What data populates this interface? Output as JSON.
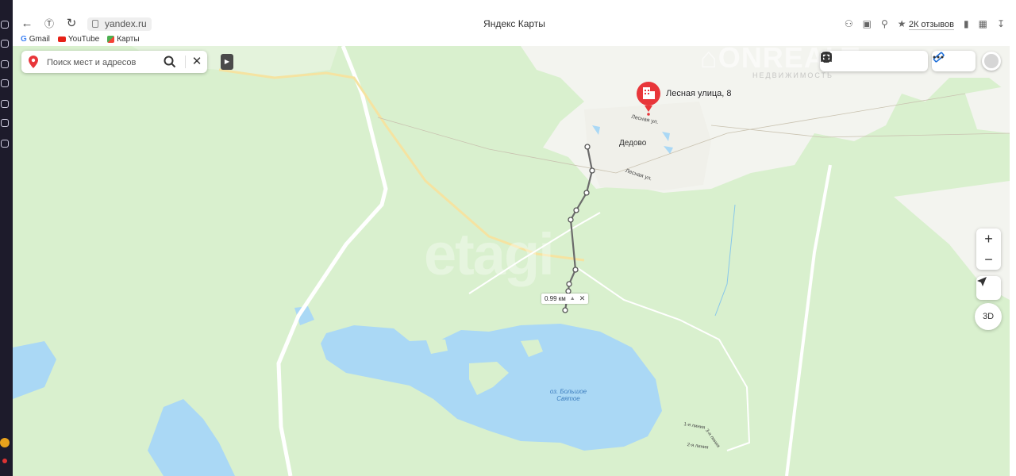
{
  "browser": {
    "url": "yandex.ru",
    "title": "Яндекс Карты",
    "reviews": "2К отзывов",
    "nav": {
      "back_icon": "arrow-left-icon",
      "yandex_icon": "yandex-logo-icon",
      "reload_icon": "reload-icon"
    },
    "bookmarks": [
      {
        "label": "Gmail",
        "icon": "gmail-icon"
      },
      {
        "label": "YouTube",
        "icon": "youtube-icon"
      },
      {
        "label": "Карты",
        "icon": "maps-icon"
      }
    ]
  },
  "search": {
    "placeholder": "Поиск мест и адресов"
  },
  "map": {
    "marker_label": "Лесная улица, 8",
    "village": "Дедово",
    "street_1": "Лесная ул.",
    "street_2": "Лесная ул.",
    "lake": "оз. Большое Святое",
    "line_1": "1-я линия",
    "line_2": "2-я линия",
    "line_3": "3-я линия",
    "distance": "0.99 км",
    "three_d": "3D",
    "zoom_in": "+",
    "zoom_out": "−"
  },
  "watermarks": {
    "etagi": "etagi",
    "onrealt": "ONREALT",
    "onrealt_sub": "НЕДВИЖИМОСТЬ"
  },
  "colors": {
    "forest": "#d9f0ce",
    "field": "#f3f4ef",
    "water": "#aad8f5",
    "marker": "#e8363a",
    "route": "#6b6b6b"
  }
}
